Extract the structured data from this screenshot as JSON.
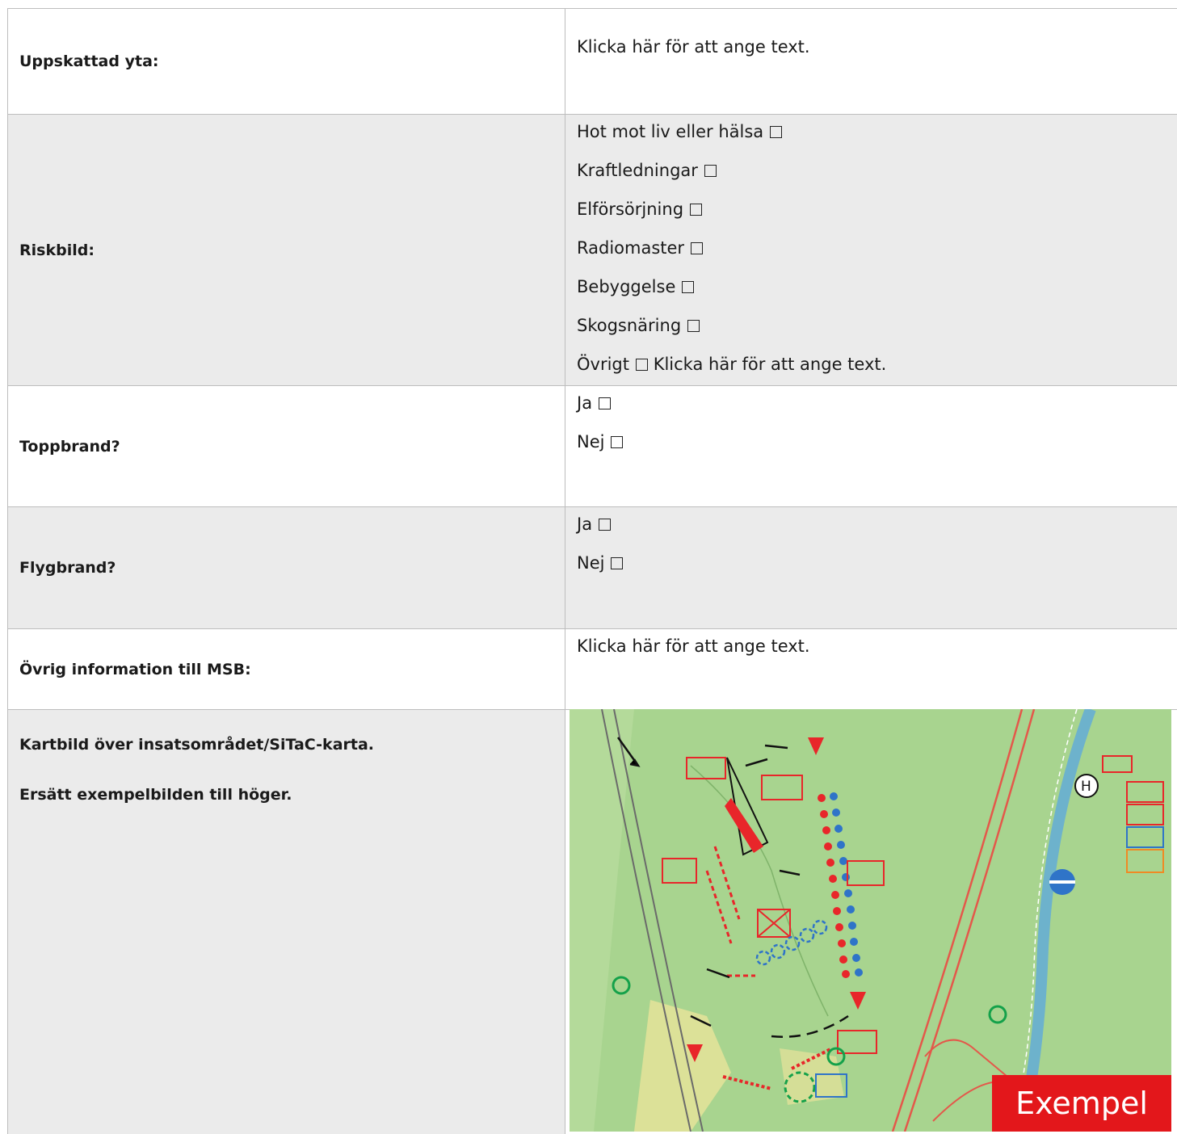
{
  "rows": {
    "area": {
      "label": "Uppskattad yta:",
      "value": "Klicka här för att ange text."
    },
    "risk": {
      "label": "Riskbild:",
      "options": [
        "Hot mot liv eller hälsa",
        "Kraftledningar",
        "Elförsörjning",
        "Radiomaster",
        "Bebyggelse",
        "Skogsnäring",
        "Övrigt"
      ],
      "other_placeholder": "Klicka här för att ange text."
    },
    "topfire": {
      "label": "Toppbrand?",
      "yes": "Ja",
      "no": "Nej"
    },
    "flyfire": {
      "label": "Flygbrand?",
      "yes": "Ja",
      "no": "Nej"
    },
    "other_info": {
      "label": "Övrig information till MSB:",
      "value": "Klicka här för att ange text."
    },
    "map": {
      "label_1": "Kartbild över insatsområdet/SiTaC-karta.",
      "label_2": "Ersätt exempelbilden till höger.",
      "stamp": "Exempel"
    }
  },
  "colors": {
    "border": "#bdbdbd",
    "shaded_row": "#ebebeb",
    "stamp": "#e3171b",
    "map_green": "#9fcf8a"
  }
}
